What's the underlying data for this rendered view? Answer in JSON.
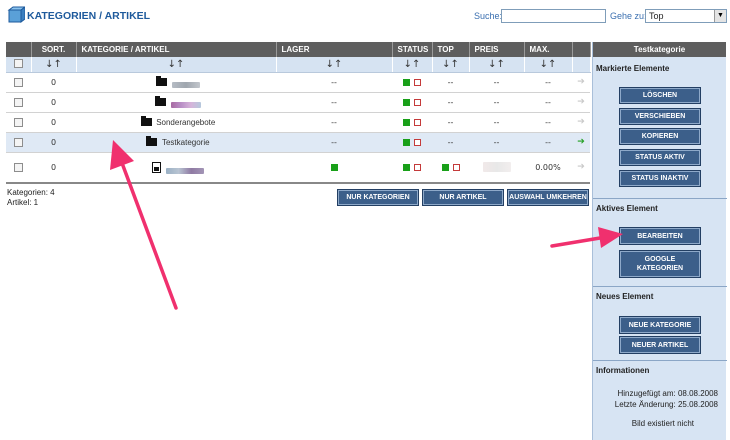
{
  "header": {
    "title": "KATEGORIEN / ARTIKEL",
    "search_label": "Suche:",
    "search_value": "",
    "goto_label": "Gehe zu:",
    "goto_value": "Top"
  },
  "table": {
    "columns": [
      "SORT.",
      "KATEGORIE / ARTIKEL",
      "LAGER",
      "STATUS",
      "TOP",
      "PREIS",
      "MAX."
    ],
    "sort_icon": "↓↑",
    "rows": [
      {
        "sort": "0",
        "type": "category",
        "name": "",
        "lager": "--",
        "top": "--",
        "preis": "--",
        "max": "--"
      },
      {
        "sort": "0",
        "type": "category",
        "name": "",
        "lager": "--",
        "top": "--",
        "preis": "--",
        "max": "--"
      },
      {
        "sort": "0",
        "type": "category",
        "name": "Sonderangebote",
        "lager": "--",
        "top": "--",
        "preis": "--",
        "max": "--"
      },
      {
        "sort": "0",
        "type": "category",
        "name": "Testkategorie",
        "lager": "--",
        "top": "--",
        "preis": "--",
        "max": "--"
      },
      {
        "sort": "0",
        "type": "article",
        "name": "",
        "lager": "",
        "top": "",
        "preis": "",
        "max": "0.00%"
      }
    ]
  },
  "footer": {
    "categories_count": "Kategorien: 4",
    "articles_count": "Artikel: 1",
    "btn_only_categories": "NUR KATEGORIEN",
    "btn_only_articles": "NUR ARTIKEL",
    "btn_invert_selection": "AUSWAHL UMKEHREN"
  },
  "panel": {
    "title": "Testkategorie",
    "marked_title": "Markierte Elemente",
    "btn_delete": "LÖSCHEN",
    "btn_move": "VERSCHIEBEN",
    "btn_copy": "KOPIEREN",
    "btn_status_active": "STATUS AKTIV",
    "btn_status_inactive": "STATUS INAKTIV",
    "active_title": "Aktives Element",
    "btn_edit": "BEARBEITEN",
    "btn_google_line1": "GOOGLE",
    "btn_google_line2": "KATEGORIEN",
    "new_title": "Neues Element",
    "btn_new_category": "NEUE KATEGORIE",
    "btn_new_article": "NEUER ARTIKEL",
    "info_title": "Informationen",
    "added_on": "Hinzugefügt am: 08.08.2008",
    "last_change": "Letzte Änderung: 25.08.2008",
    "image_missing": "Bild existiert nicht"
  },
  "colors": {
    "accent_blue": "#1e5a9c",
    "button_blue": "#3c5f8a",
    "header_gray": "#5e5e5e",
    "panel_bg": "#d7e4f3",
    "status_green": "#19a019",
    "status_red": "#c43a3a",
    "annotation_pink": "#f0306e"
  },
  "icons": {
    "logo": "product-box-icon",
    "folder": "folder-icon",
    "article": "article-icon",
    "sort": "sort-arrows-icon",
    "row_arrow": "arrow-right-icon"
  }
}
